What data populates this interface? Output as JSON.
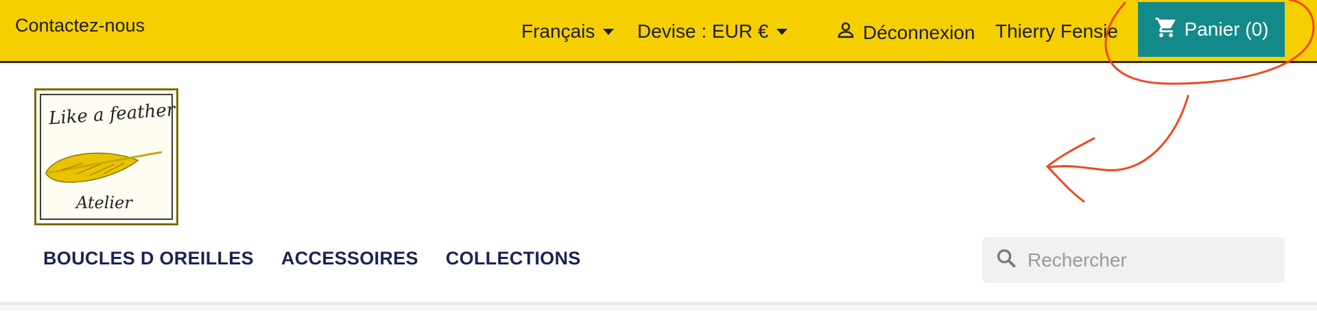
{
  "topbar": {
    "contact": "Contactez-nous",
    "language": "Français",
    "currency": "Devise : EUR €",
    "logout": "Déconnexion",
    "username": "Thierry Fensie",
    "cart": "Panier (0)"
  },
  "logo": {
    "line1": "Like a feather",
    "line2": "Atelier"
  },
  "nav": {
    "items": [
      "BOUCLES D OREILLES",
      "ACCESSOIRES",
      "COLLECTIONS"
    ]
  },
  "search": {
    "placeholder": "Rechercher"
  },
  "colors": {
    "topbar": "#f6cf00",
    "cart": "#138a8a",
    "nav_text": "#1c2250",
    "annotation": "#f0461e"
  },
  "icons": [
    "user-icon",
    "cart-icon",
    "search-icon",
    "chevron-down-icon",
    "feather-icon"
  ]
}
